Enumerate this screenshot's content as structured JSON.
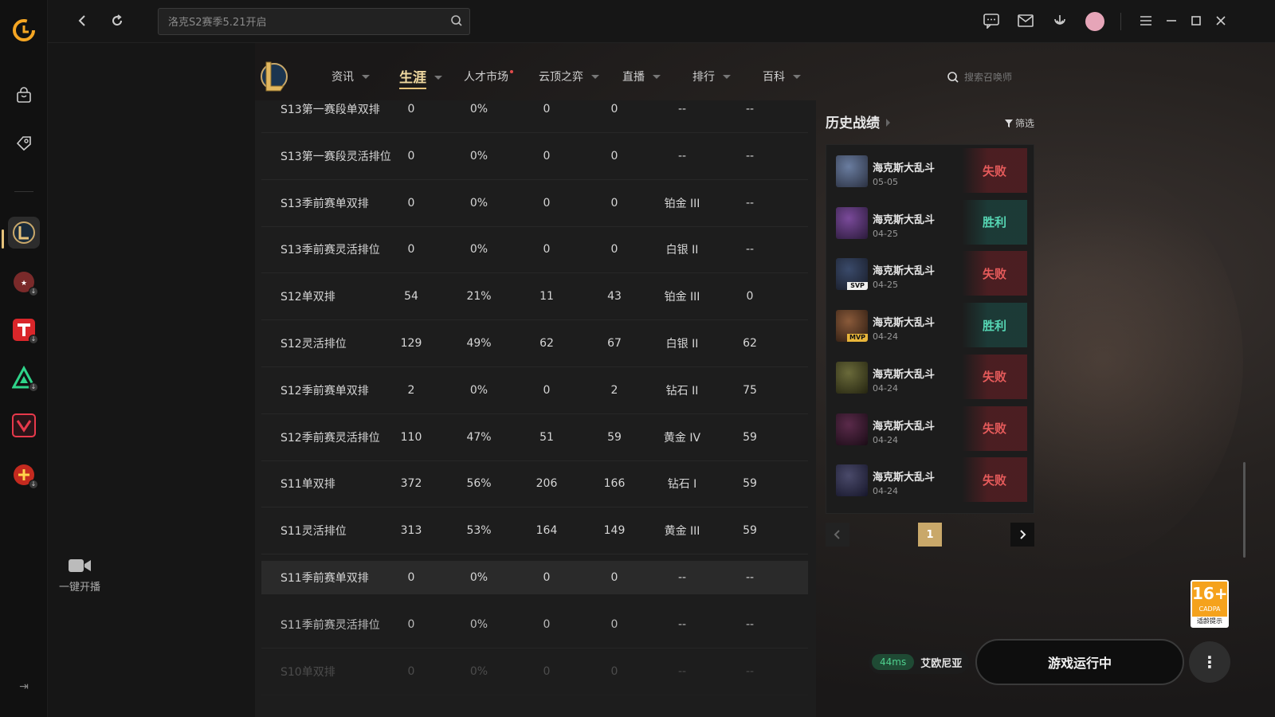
{
  "topbar": {
    "search_placeholder": "洛克S2赛季5.21开启"
  },
  "sidebar": {
    "stream_label": "一键开播"
  },
  "nav": {
    "items": [
      {
        "label": "资讯"
      },
      {
        "label": "生涯"
      },
      {
        "label": "人才市场"
      },
      {
        "label": "云顶之弈"
      },
      {
        "label": "直播"
      },
      {
        "label": "排行"
      },
      {
        "label": "百科"
      }
    ],
    "search_placeholder": "搜索召唤师"
  },
  "ranked_table": {
    "rows": [
      {
        "season": "S13第一赛段单双排",
        "games": "0",
        "winrate": "0%",
        "wins": "0",
        "losses": "0",
        "tier": "--",
        "points": "--"
      },
      {
        "season": "S13第一赛段灵活排位",
        "games": "0",
        "winrate": "0%",
        "wins": "0",
        "losses": "0",
        "tier": "--",
        "points": "--"
      },
      {
        "season": "S13季前赛单双排",
        "games": "0",
        "winrate": "0%",
        "wins": "0",
        "losses": "0",
        "tier": "铂金 III",
        "points": "--"
      },
      {
        "season": "S13季前赛灵活排位",
        "games": "0",
        "winrate": "0%",
        "wins": "0",
        "losses": "0",
        "tier": "白银 II",
        "points": "--"
      },
      {
        "season": "S12单双排",
        "games": "54",
        "winrate": "21%",
        "wins": "11",
        "losses": "43",
        "tier": "铂金 III",
        "points": "0"
      },
      {
        "season": "S12灵活排位",
        "games": "129",
        "winrate": "49%",
        "wins": "62",
        "losses": "67",
        "tier": "白银 II",
        "points": "62"
      },
      {
        "season": "S12季前赛单双排",
        "games": "2",
        "winrate": "0%",
        "wins": "0",
        "losses": "2",
        "tier": "钻石 II",
        "points": "75"
      },
      {
        "season": "S12季前赛灵活排位",
        "games": "110",
        "winrate": "47%",
        "wins": "51",
        "losses": "59",
        "tier": "黄金 IV",
        "points": "59"
      },
      {
        "season": "S11单双排",
        "games": "372",
        "winrate": "56%",
        "wins": "206",
        "losses": "166",
        "tier": "钻石 I",
        "points": "59"
      },
      {
        "season": "S11灵活排位",
        "games": "313",
        "winrate": "53%",
        "wins": "164",
        "losses": "149",
        "tier": "黄金 III",
        "points": "59"
      },
      {
        "season": "S11季前赛单双排",
        "games": "0",
        "winrate": "0%",
        "wins": "0",
        "losses": "0",
        "tier": "--",
        "points": "--"
      },
      {
        "season": "S11季前赛灵活排位",
        "games": "0",
        "winrate": "0%",
        "wins": "0",
        "losses": "0",
        "tier": "--",
        "points": "--"
      },
      {
        "season": "S10单双排",
        "games": "0",
        "winrate": "0%",
        "wins": "0",
        "losses": "0",
        "tier": "--",
        "points": "--"
      }
    ]
  },
  "history": {
    "title": "历史战绩",
    "filter_label": "筛选",
    "matches": [
      {
        "mode": "海克斯大乱斗",
        "date": "05-05",
        "result": "失败",
        "win": false,
        "badge": ""
      },
      {
        "mode": "海克斯大乱斗",
        "date": "04-25",
        "result": "胜利",
        "win": true,
        "badge": ""
      },
      {
        "mode": "海克斯大乱斗",
        "date": "04-25",
        "result": "失败",
        "win": false,
        "badge": "SVP"
      },
      {
        "mode": "海克斯大乱斗",
        "date": "04-24",
        "result": "胜利",
        "win": true,
        "badge": "MVP"
      },
      {
        "mode": "海克斯大乱斗",
        "date": "04-24",
        "result": "失败",
        "win": false,
        "badge": ""
      },
      {
        "mode": "海克斯大乱斗",
        "date": "04-24",
        "result": "失败",
        "win": false,
        "badge": ""
      },
      {
        "mode": "海克斯大乱斗",
        "date": "04-24",
        "result": "失败",
        "win": false,
        "badge": ""
      }
    ],
    "page": "1"
  },
  "age_rating": {
    "age": "16+",
    "org": "CADPA",
    "note": "适龄提示"
  },
  "status": {
    "ping": "44ms",
    "region": "艾欧尼亚",
    "play_label": "游戏运行中"
  },
  "colors": {
    "accent_gold": "#e5c27a",
    "loss_red": "#e65b5b",
    "win_teal": "#56d6b4"
  }
}
